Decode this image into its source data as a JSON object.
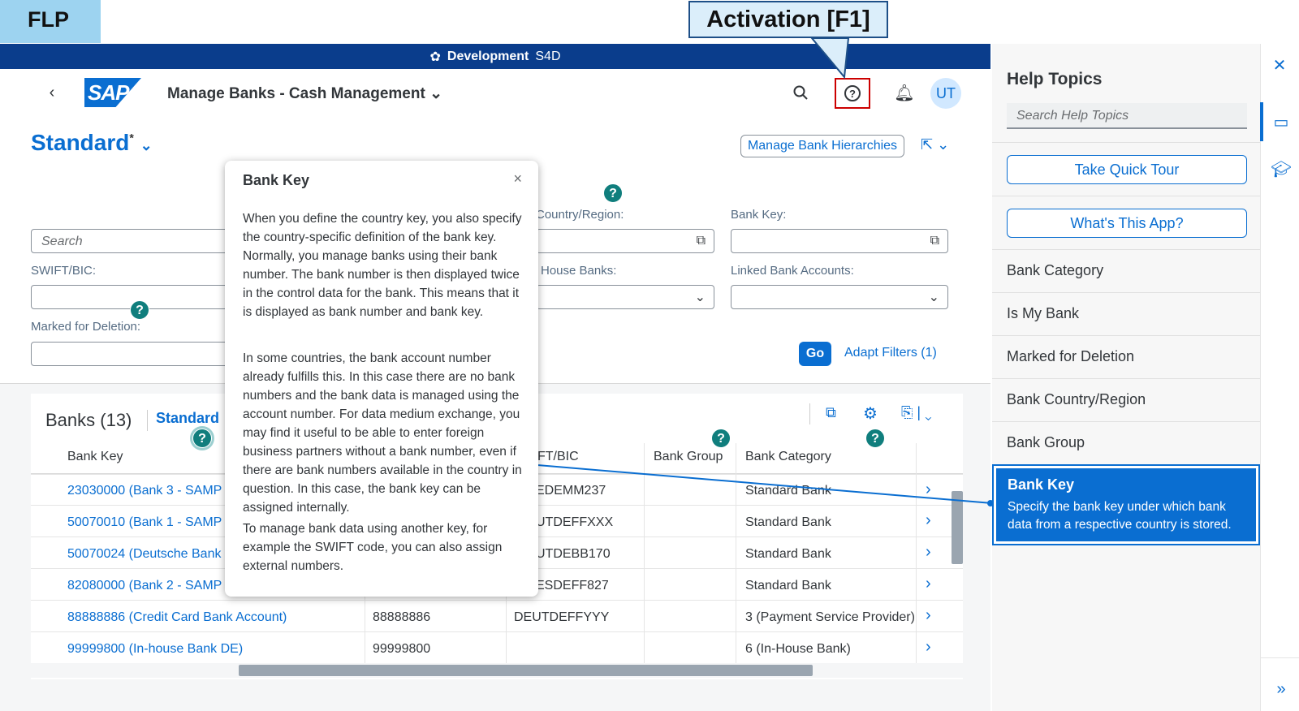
{
  "annotations": {
    "flp": "FLP",
    "activation": "Activation [F1]"
  },
  "devbar": {
    "env": "Development",
    "system": "S4D"
  },
  "shell": {
    "back_icon": "chevron-left-icon",
    "logo": "SAP",
    "app_title": "Manage Banks - Cash Management",
    "avatar": "UT"
  },
  "page": {
    "variant": "Standard",
    "variant_star": "*",
    "manage_hierarchies": "Manage Bank Hierarchies",
    "search_placeholder": "Search",
    "filters": {
      "country": "Country/Region:",
      "bank_key": "Bank Key:",
      "swift": "SWIFT/BIC:",
      "house_banks": "House Banks:",
      "linked_accounts": "Linked Bank Accounts:",
      "marked_deletion": "Marked for Deletion:"
    },
    "go": "Go",
    "adapt_filters": "Adapt Filters (1)"
  },
  "table": {
    "title": "Banks (13)",
    "variant": "Standard",
    "headers": [
      "Bank Key",
      "FT/BIC",
      "Bank Group",
      "Bank Category"
    ],
    "rows": [
      {
        "name": "23030000 (Bank 3 - SAMP",
        "num": "",
        "swift": "EDEMM237",
        "cat": "Standard Bank"
      },
      {
        "name": "50070010 (Bank 1 - SAMP",
        "num": "",
        "swift": "UTDEFFXXX",
        "cat": "Standard Bank"
      },
      {
        "name": "50070024 (Deutsche Bank",
        "num": "",
        "swift": "UTDEBB170",
        "cat": "Standard Bank"
      },
      {
        "name": "82080000 (Bank 2 - SAMP",
        "num": "",
        "swift": "ESDEFF827",
        "cat": "Standard Bank"
      },
      {
        "name": "88888886 (Credit Card Bank Account)",
        "num": "88888886",
        "swift": "DEUTDEFFYYY",
        "cat": "3 (Payment Service Provider)"
      },
      {
        "name": "99999800 (In-house Bank DE)",
        "num": "99999800",
        "swift": "",
        "cat": "6 (In-House Bank)"
      }
    ]
  },
  "popover": {
    "title": "Bank Key",
    "p1": "When you define the country key, you also specify the country-specific definition of the bank key. Normally, you manage banks using their bank number. The bank number is then displayed twice in the control data for the bank. This means that it is displayed as bank number and bank key.",
    "p2": "In some countries, the bank account number already fulfills this. In this case there are no bank numbers and the bank data is managed using the account number. For data medium exchange, you may find it useful to be able to enter foreign business partners without a bank number, even if there are bank numbers available in the country in question. In this case, the bank key can be assigned internally.",
    "p3": "To manage bank data using another key, for example the SWIFT code, you can also assign external numbers."
  },
  "help": {
    "title": "Help Topics",
    "search_placeholder": "Search Help Topics",
    "tour": "Take Quick Tour",
    "whats_this": "What's This App?",
    "topics": [
      "Bank Category",
      "Is My Bank",
      "Marked for Deletion",
      "Bank Country/Region",
      "Bank Group"
    ],
    "selected": {
      "title": "Bank Key",
      "desc": "Specify the bank key under which bank data from a respective country is stored."
    }
  },
  "colors": {
    "brand": "#0a6ed1",
    "devbar": "#0a3d8c",
    "help_badge": "#107e7d"
  }
}
